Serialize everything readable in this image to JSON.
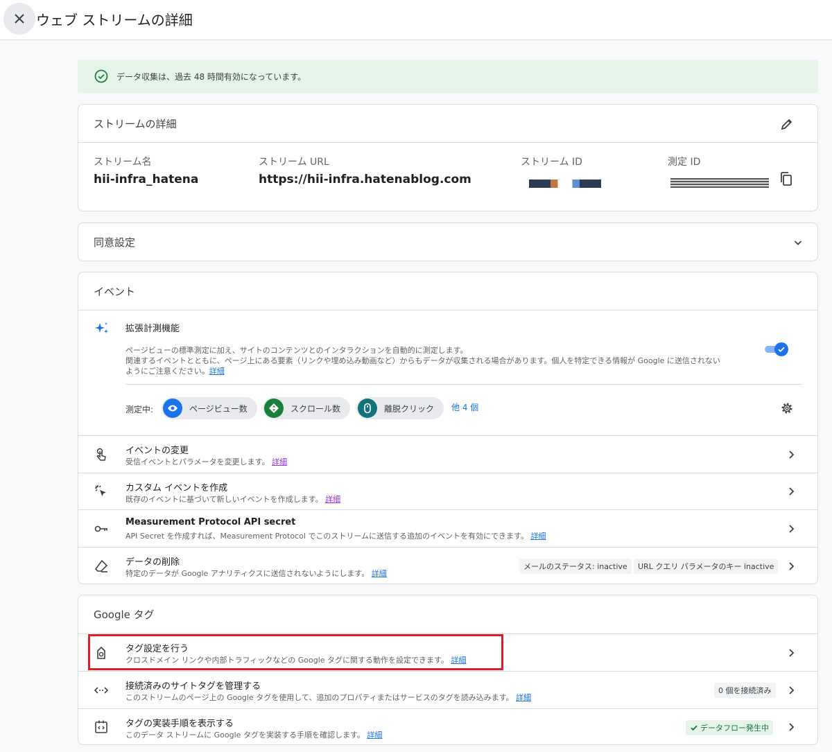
{
  "header": {
    "title": "ウェブ ストリームの詳細"
  },
  "banner": {
    "text": "データ収集は、過去 48 時間有効になっています。"
  },
  "stream_details": {
    "title": "ストリームの詳細",
    "name_label": "ストリーム名",
    "name_value": "hii-infra_hatena",
    "url_label": "ストリーム URL",
    "url_value": "https://hii-infra.hatenablog.com",
    "id_label": "ストリーム ID",
    "measurement_label": "測定 ID"
  },
  "consent": {
    "title": "同意設定"
  },
  "events": {
    "title": "イベント",
    "enhanced": {
      "title": "拡張計測機能",
      "desc_line1": "ページビューの標準測定に加え、サイトのコンテンツとのインタラクションを自動的に測定します。",
      "desc_line2": "関連するイベントとともに、ページ上にある要素（リンクや埋め込み動画など）からもデータが収集される場合があります。個人を特定できる情報が Google に送信されない",
      "desc_line3": "ようにご注意ください。",
      "link": "詳細",
      "enabled": true
    },
    "measuring_label": "測定中:",
    "chips": [
      {
        "label": "ページビュー数",
        "color": "#1a73e8"
      },
      {
        "label": "スクロール数",
        "color": "#188038"
      },
      {
        "label": "離脱クリック",
        "color": "#12737d"
      }
    ],
    "more": "他 4 個",
    "rows": [
      {
        "title": "イベントの変更",
        "desc": "受信イベントとパラメータを変更します。",
        "link": "詳細"
      },
      {
        "title": "カスタム イベントを作成",
        "desc": "既存のイベントに基づいて新しいイベントを作成します。",
        "link": "詳細"
      },
      {
        "title": "Measurement Protocol API secret",
        "desc": "API Secret を作成すれば、Measurement Protocol でこのストリームに送信する追加のイベントを有効にできます。",
        "link": "詳細"
      },
      {
        "title": "データの削除",
        "desc": "特定のデータが Google アナリティクスに送信されないようにします。",
        "link": "詳細",
        "pill1": "メールのステータス: inactive",
        "pill2": "URL クエリ パラメータのキー inactive"
      }
    ]
  },
  "google_tag": {
    "title": "Google タグ",
    "rows": [
      {
        "title": "タグ設定を行う",
        "desc": "クロスドメイン リンクや内部トラフィックなどの Google タグに関する動作を設定できます。",
        "link": "詳細"
      },
      {
        "title": "接続済みのサイトタグを管理する",
        "desc": "このストリームのページ上の Google タグを使用して、追加のプロパティまたはサービスのタグを読み込みます。",
        "link": "詳細",
        "badge": "0 個を接続済み"
      },
      {
        "title": "タグの実装手順を表示する",
        "desc": "このデータ ストリームに Google タグを実装する手順を確認します。",
        "link": "詳細",
        "status": "データフロー発生中"
      }
    ]
  }
}
